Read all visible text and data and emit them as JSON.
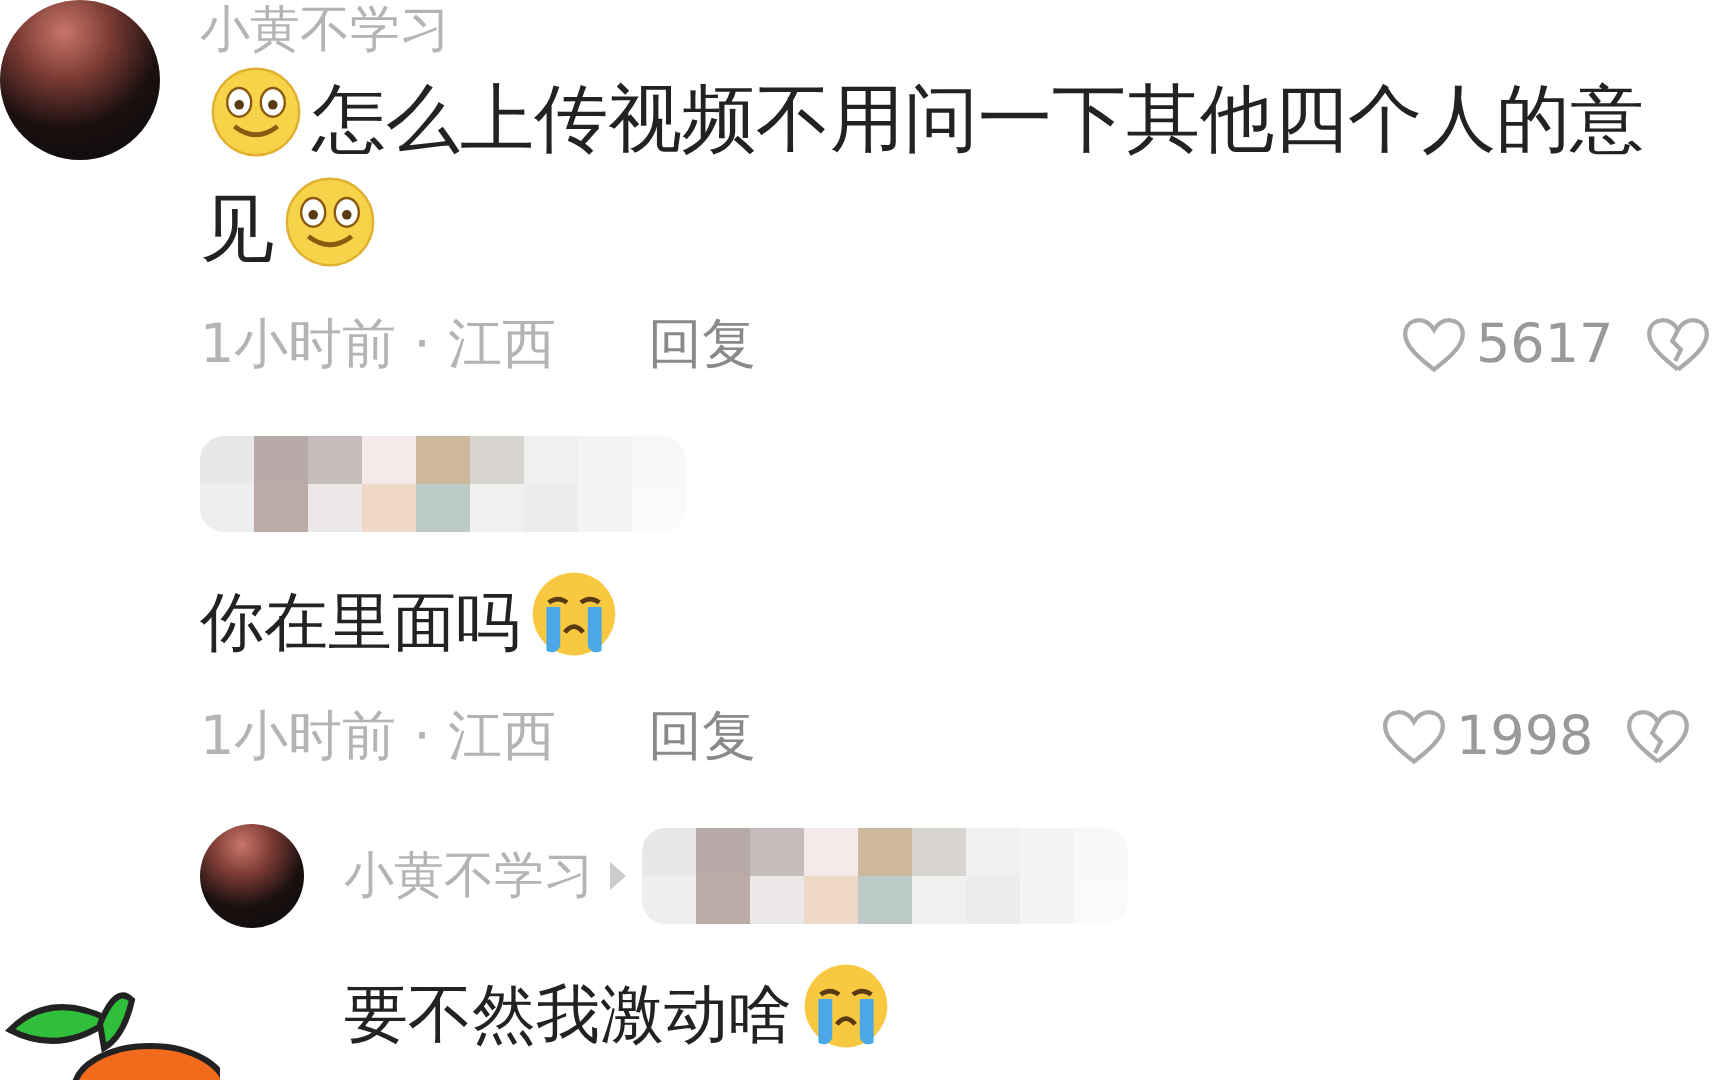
{
  "comment": {
    "author": "小黄不学习",
    "body": [
      {
        "kind": "smile"
      },
      {
        "kind": "text",
        "text": "怎么上传视频不用问一下其他四个人的意"
      },
      {
        "kind": "text",
        "text": "见"
      },
      {
        "kind": "smile"
      }
    ],
    "time": "1小时前 · 江西",
    "reply": "回复",
    "likes": "5617"
  },
  "replies": [
    {
      "kind": "anonymous",
      "body": [
        {
          "kind": "text",
          "text": "你在里面吗"
        },
        {
          "kind": "cry"
        }
      ],
      "time": "1小时前 · 江西",
      "reply": "回复",
      "likes": "1998"
    },
    {
      "kind": "reply-to",
      "author": "小黄不学习",
      "body": [
        {
          "kind": "text",
          "text": "要不然我激动啥"
        },
        {
          "kind": "cry"
        }
      ]
    }
  ]
}
